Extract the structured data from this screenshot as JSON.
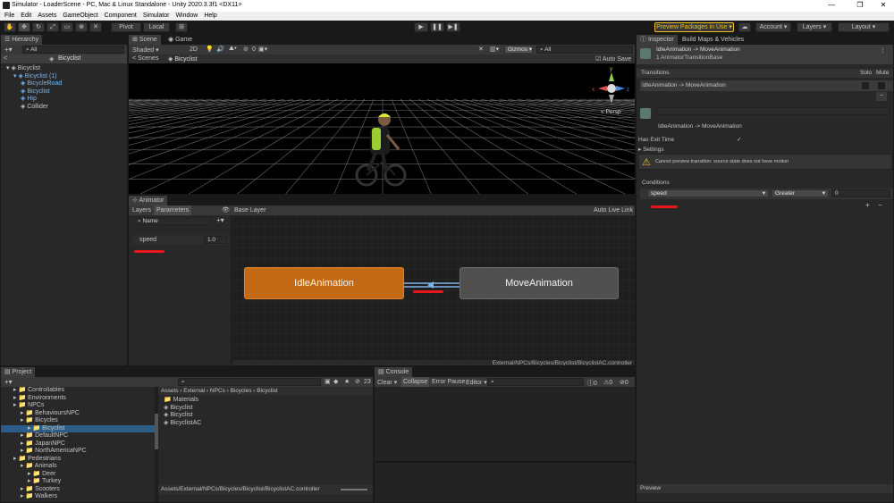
{
  "window": {
    "title": "Simulator - LoaderScene - PC, Mac & Linux Standalone - Unity 2020.3.3f1 <DX11>",
    "controls": [
      "—",
      "❐",
      "✕"
    ]
  },
  "menu": [
    "File",
    "Edit",
    "Assets",
    "GameObject",
    "Component",
    "Simulator",
    "Window",
    "Help"
  ],
  "toolbar": {
    "pivot": "Pivot",
    "local": "Local",
    "preview_packages": "Preview Packages in Use ▾",
    "account": "Account ▾",
    "layers": "Layers ▾",
    "layout": "Layout ▾"
  },
  "hierarchy": {
    "tab": "Hierarchy",
    "search_placeholder": "All",
    "header": "Bicyclist",
    "items": [
      {
        "label": "Bicyclist",
        "indent": 0,
        "blue": false
      },
      {
        "label": "Bicyclist (1)",
        "indent": 1,
        "blue": true
      },
      {
        "label": "BicycleRoad",
        "indent": 2,
        "blue": true
      },
      {
        "label": "Bicyclist",
        "indent": 2,
        "blue": true
      },
      {
        "label": "Hip",
        "indent": 2,
        "blue": true
      },
      {
        "label": "Collider",
        "indent": 2,
        "blue": false
      }
    ]
  },
  "scene": {
    "tabs": [
      "Scene",
      "Game"
    ],
    "shading": "Shaded",
    "mode_2d": "2D",
    "gizmos": "Gizmos ▾",
    "search_placeholder": "All",
    "breadcrumb_root": "Scenes",
    "breadcrumb_current": "Bicyclist",
    "auto_save": "Auto Save",
    "persp": "< Persp",
    "hidden_count": "0"
  },
  "animator": {
    "tab": "Animator",
    "subtabs": [
      "Layers",
      "Parameters"
    ],
    "name_placeholder": "Name",
    "base_layer": "Base Layer",
    "auto_live_link": "Auto Live Link",
    "param_name": "speed",
    "param_value": "1.0",
    "node_idle": "IdleAnimation",
    "node_move": "MoveAnimation",
    "path": "External/NPCs/Bicycles/Bicyclist/BicyclistAC.controller"
  },
  "inspector": {
    "tabs": [
      "Inspector",
      "Build Maps & Vehicles"
    ],
    "title": "IdleAnimation -> MoveAnimation",
    "subtitle": "1 AnimatorTransitionBase",
    "transitions_label": "Transitions",
    "solo": "Solo",
    "mute": "Mute",
    "transition_row": "IdleAnimation -> MoveAnimation",
    "transition_name_2": "IdleAnimation -> MoveAnimation",
    "has_exit_time": "Has Exit Time",
    "settings": "Settings",
    "warning": "Cannot preview transition: source state does not have motion",
    "conditions": "Conditions",
    "cond_param": "speed",
    "cond_op": "Greater",
    "cond_value": "0",
    "preview": "Preview",
    "add": "+",
    "remove": "−"
  },
  "project": {
    "tab": "Project",
    "tree": [
      {
        "label": "Controllables",
        "indent": 1
      },
      {
        "label": "Environments",
        "indent": 1
      },
      {
        "label": "NPCs",
        "indent": 1
      },
      {
        "label": "BehavioursNPC",
        "indent": 2
      },
      {
        "label": "Bicycles",
        "indent": 2
      },
      {
        "label": "Bicyclist",
        "indent": 3
      },
      {
        "label": "DefaultNPC",
        "indent": 2
      },
      {
        "label": "JapanNPC",
        "indent": 2
      },
      {
        "label": "NorthAmericaNPC",
        "indent": 2
      },
      {
        "label": "Pedestrians",
        "indent": 1
      },
      {
        "label": "Animals",
        "indent": 2
      },
      {
        "label": "Deer",
        "indent": 3
      },
      {
        "label": "Turkey",
        "indent": 3
      },
      {
        "label": "Scooters",
        "indent": 2
      },
      {
        "label": "Walkers",
        "indent": 2
      }
    ],
    "breadcrumb": [
      "Assets",
      "External",
      "NPCs",
      "Bicycles",
      "Bicyclist"
    ],
    "files": [
      "Materials",
      "Bicyclist",
      "Bicyclist",
      "BicyclistAC"
    ],
    "footer_path": "Assets/External/NPCs/Bicycles/Bicyclist/BicyclistAC.controller",
    "count": "23"
  },
  "console": {
    "tab": "Console",
    "clear": "Clear ▾",
    "collapse": "Collapse",
    "error_pause": "Error Pause",
    "editor": "Editor ▾",
    "counts": [
      "0",
      "0",
      "0"
    ]
  }
}
